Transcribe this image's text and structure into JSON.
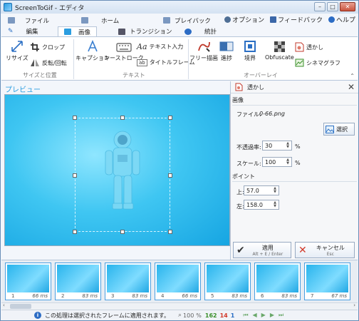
{
  "window": {
    "title": "ScreenToGif - エディタ",
    "min_label": "–",
    "max_label": "□",
    "close_label": "✕"
  },
  "tabs_row1": [
    {
      "label": "ファイル"
    },
    {
      "label": "ホーム"
    },
    {
      "label": "プレイバック"
    }
  ],
  "tabs_row2": [
    {
      "label": "編集"
    },
    {
      "label": "画像"
    },
    {
      "label": "トランジション"
    },
    {
      "label": "統計"
    }
  ],
  "top_links": {
    "options": "オプション",
    "feedback": "フィードバック",
    "help": "ヘルプ"
  },
  "ribbon": {
    "resize": "リサイズ",
    "crop": "クロップ",
    "flip_rotate": "反転/回転",
    "size_group": "サイズと位置",
    "caption": "キャプション",
    "keystroke": "キーストローク",
    "text_input": "テキスト入力",
    "title_frame": "タイトルフレーム",
    "text_group": "テキスト",
    "free_draw": "フリー描画",
    "progress": "進捗",
    "border": "境界",
    "obfuscate": "Obfuscate",
    "watermark": "透かし",
    "cinemagraph": "シネマグラフ",
    "overlay_group": "オーバーレイ"
  },
  "preview": {
    "label": "プレビュー"
  },
  "panel": {
    "title": "透かし",
    "image_section": "画像",
    "file_label": "ファイル:",
    "file_value": "0-66.png",
    "select_button": "選択",
    "opacity_label": "不透過率:",
    "opacity_value": "30",
    "opacity_unit": "%",
    "scale_label": "スケール:",
    "scale_value": "100",
    "scale_unit": "%",
    "point_section": "ポイント",
    "top_label": "上:",
    "top_value": "57.0",
    "left_label": "左:",
    "left_value": "158.0",
    "apply_label": "適用",
    "apply_shortcut": "Alt + E / Enter",
    "cancel_label": "キャンセル",
    "cancel_shortcut": "Esc"
  },
  "frames": [
    {
      "num": "1",
      "dur": "66 ms"
    },
    {
      "num": "2",
      "dur": "83 ms"
    },
    {
      "num": "3",
      "dur": "83 ms"
    },
    {
      "num": "4",
      "dur": "66 ms"
    },
    {
      "num": "5",
      "dur": "83 ms"
    },
    {
      "num": "6",
      "dur": "83 ms"
    },
    {
      "num": "7",
      "dur": "67 ms"
    }
  ],
  "status": {
    "message": "この処理は選択されたフレームに適用されます。",
    "zoom": "100",
    "zoom_unit": "%",
    "total_frames": "162",
    "selected_frames": "14",
    "current_frame": "1"
  },
  "colors": {
    "accent": "#2b9de0",
    "preview_bg": "#16a5e2",
    "count_green": "#3a8f2a",
    "count_red": "#d23a2a"
  }
}
